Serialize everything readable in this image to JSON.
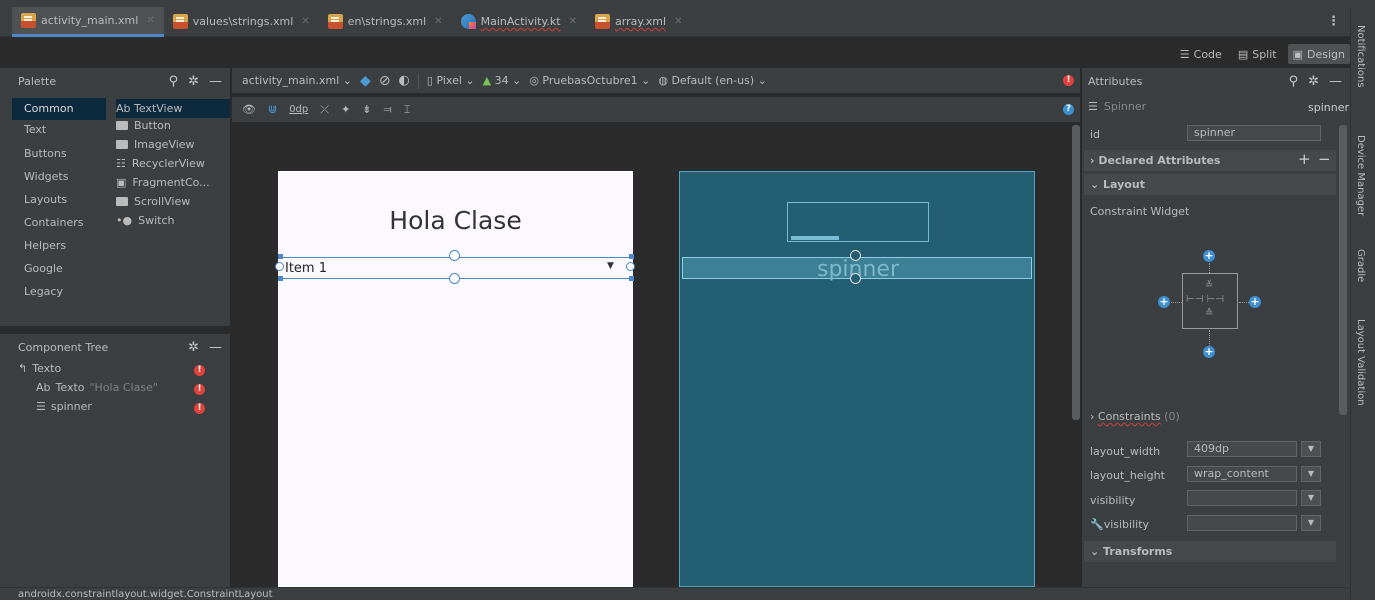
{
  "tabs": [
    {
      "label": "activity_main.xml",
      "icon": "xml-file-icon",
      "active": true
    },
    {
      "label": "values\\strings.xml",
      "icon": "xml-file-icon"
    },
    {
      "label": "en\\strings.xml",
      "icon": "xml-file-icon"
    },
    {
      "label": "MainActivity.kt",
      "icon": "kotlin-file-icon"
    },
    {
      "label": "array.xml",
      "icon": "xml-file-icon"
    }
  ],
  "view_modes": {
    "code": "Code",
    "split": "Split",
    "design": "Design"
  },
  "right_strip": {
    "notifications": "Notifications",
    "device_manager": "Device Manager",
    "gradle": "Gradle",
    "layout_validation": "Layout Validation"
  },
  "palette": {
    "title": "Palette",
    "categories": [
      "Common",
      "Text",
      "Buttons",
      "Widgets",
      "Layouts",
      "Containers",
      "Helpers",
      "Google",
      "Legacy"
    ],
    "widgets": [
      "Ab TextView",
      "Button",
      "ImageView",
      "RecyclerView",
      "FragmentCo...",
      "ScrollView",
      "Switch"
    ]
  },
  "component_tree": {
    "title": "Component Tree",
    "root": "Texto",
    "items": [
      {
        "prefix": "Ab",
        "label": "Texto",
        "hint": "\"Hola Clase\""
      },
      {
        "label": "spinner"
      }
    ]
  },
  "design_toolbar": {
    "file": "activity_main.xml",
    "device": "Pixel",
    "api": "34",
    "theme": "PruebasOctubre1",
    "locale": "Default (en-us)",
    "margin": "0dp"
  },
  "design_view": {
    "title_text": "Hola Clase",
    "spinner_item": "Item 1"
  },
  "blueprint_view": {
    "spinner_label": "spinner"
  },
  "attributes": {
    "title": "Attributes",
    "component_type": "Spinner",
    "component_id": "spinner",
    "id_label": "id",
    "id_value": "spinner",
    "declared": "Declared Attributes",
    "layout": "Layout",
    "constraint_widget": "Constraint Widget",
    "constraints": "Constraints",
    "constraints_count": "(0)",
    "rows": [
      {
        "label": "layout_width",
        "value": "409dp"
      },
      {
        "label": "layout_height",
        "value": "wrap_content"
      },
      {
        "label": "visibility",
        "value": ""
      },
      {
        "label": "visibility",
        "value": ""
      }
    ],
    "transforms": "Transforms"
  },
  "status_bar": "androidx.constraintlayout.widget.ConstraintLayout",
  "colors": {
    "accent": "#4a88c7",
    "blueprint": "#245e72",
    "error": "#e0423c"
  }
}
